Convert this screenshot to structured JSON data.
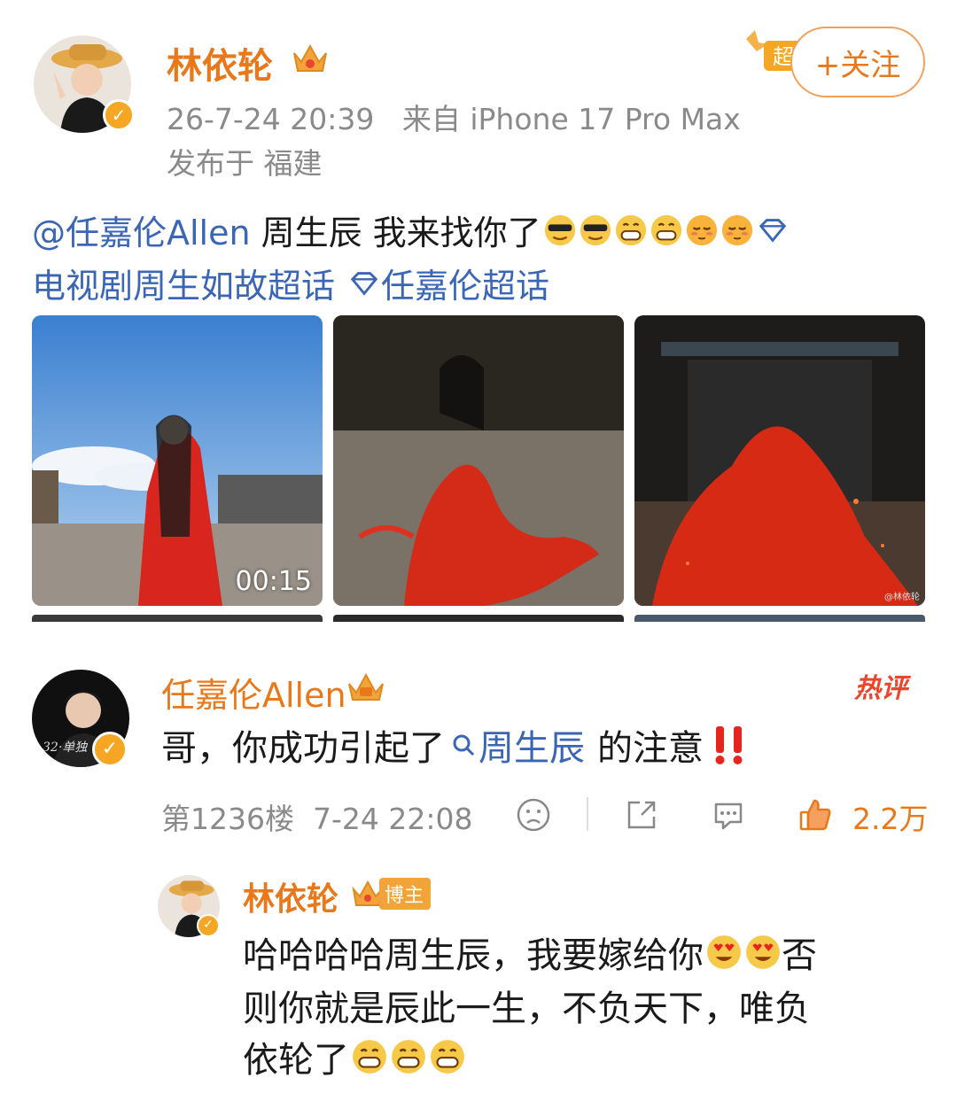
{
  "post": {
    "author": "林依轮",
    "timestamp": "26-7-24 20:39",
    "source": "来自 iPhone 17 Pro Max",
    "location": "发布于 福建",
    "follow_label": "+关注",
    "super_tag": "超",
    "text_line1_mention": "@任嘉伦Allen",
    "text_line1_body": "周生辰 我来找你了",
    "text_line2_topic1": "电视剧周生如故超话",
    "text_line2_topic2": "任嘉伦超话",
    "video_duration": "00:15",
    "image_watermark": "@林依轮"
  },
  "comment": {
    "author": "任嘉伦Allen",
    "hot_label": "热评",
    "text_before": "哥，你成功引起了",
    "text_link": "周生辰",
    "text_after": "的注意",
    "floor": "第1236楼",
    "time": "7-24 22:08",
    "like_count": "2.2万",
    "avatar_text": "32·单独"
  },
  "reply": {
    "author": "林依轮",
    "badge": "博主",
    "line1_a": "哈哈哈哈周生辰，我要嫁给你",
    "line1_b": "否",
    "line2": "则你就是辰此一生，不负天下，唯负",
    "line3": "依轮了"
  },
  "colors": {
    "accent_orange": "#e8781a",
    "link_blue": "#3a66b5",
    "hot_red": "#e8462f",
    "verified_gold": "#f5a623"
  },
  "icons": [
    "crown-icon",
    "verified-icon",
    "dislike-icon",
    "share-icon",
    "comment-icon",
    "like-icon",
    "topic-diamond-icon",
    "search-icon",
    "double-exclamation-icon"
  ]
}
